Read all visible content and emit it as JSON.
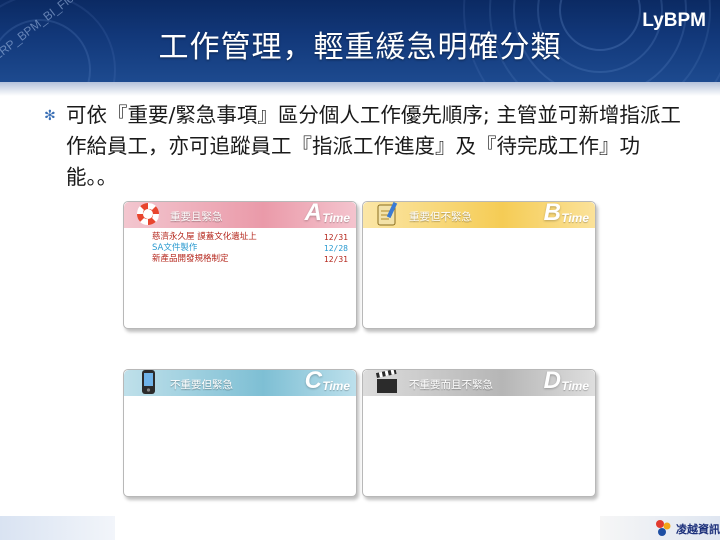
{
  "header": {
    "title": "工作管理，輕重緩急明確分類",
    "brand": "LyBPM",
    "watermark": "ERP_BPM_BI_Flow"
  },
  "bullet": {
    "text": "可依『重要/緊急事項』區分個人工作優先順序; 主管並可新增指派工作給員工，亦可追蹤員工『指派工作進度』及『待完成工作』功能。。"
  },
  "quadrants": [
    {
      "id": "a",
      "label": "重要且緊急",
      "letter": "A",
      "time": "Time",
      "icon": "lifebuoy-icon",
      "tasks": [
        {
          "name": "慈濟永久屋 謨蓋文化遺址上",
          "date": "12/31",
          "color": "#b5281e"
        },
        {
          "name": "SA文件製作",
          "date": "12/28",
          "color": "#2a9ad0"
        },
        {
          "name": "新產品開發規格制定",
          "date": "12/31",
          "color": "#b5281e"
        }
      ]
    },
    {
      "id": "b",
      "label": "重要但不緊急",
      "letter": "B",
      "time": "Time",
      "icon": "notepad-pencil-icon",
      "tasks": []
    },
    {
      "id": "c",
      "label": "不重要但緊急",
      "letter": "C",
      "time": "Time",
      "icon": "mobile-phone-icon",
      "tasks": []
    },
    {
      "id": "d",
      "label": "不重要而且不緊急",
      "letter": "D",
      "time": "Time",
      "icon": "clapperboard-icon",
      "tasks": []
    }
  ],
  "footer": {
    "logo_text": "凌越資訊",
    "logo_icon": "company-logo-icon"
  },
  "colors": {
    "header": "#12387a",
    "quad_a": "#ea9aa9",
    "quad_b": "#f5cc55",
    "quad_c": "#7ebfd4",
    "quad_d": "#b6b6b6",
    "bullet": "#3a6fb5"
  }
}
